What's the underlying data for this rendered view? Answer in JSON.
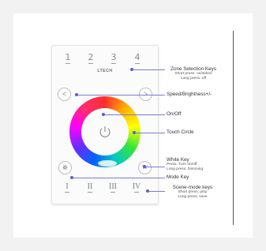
{
  "panel": {
    "brand": "LTECH",
    "zones": [
      "1",
      "2",
      "3",
      "4"
    ],
    "left_button": "<",
    "right_button": ">",
    "white_button": "W",
    "mode_button": "❁",
    "scenes": [
      "I",
      "II",
      "III",
      "IV"
    ]
  },
  "labels": {
    "zone_selection": {
      "title": "Zone Selection Keys",
      "sub1": "Short press: on/select",
      "sub2": "Long press: off"
    },
    "speed": {
      "title": "Speed/Brightness+/-"
    },
    "onoff": {
      "title": "On/Off"
    },
    "touch": {
      "title": "Touch Circle"
    },
    "white": {
      "title": "White Key",
      "sub1": "Press: Turn on/off",
      "sub2": "Long press: Dimming"
    },
    "mode": {
      "title": "Mode Key"
    },
    "scene": {
      "title": "Scene-mode keys",
      "sub1": "Short press: play",
      "sub2": "Long press: save"
    }
  },
  "colors": {
    "accent": "#5a5ad0",
    "background": "#f2f2f2"
  }
}
